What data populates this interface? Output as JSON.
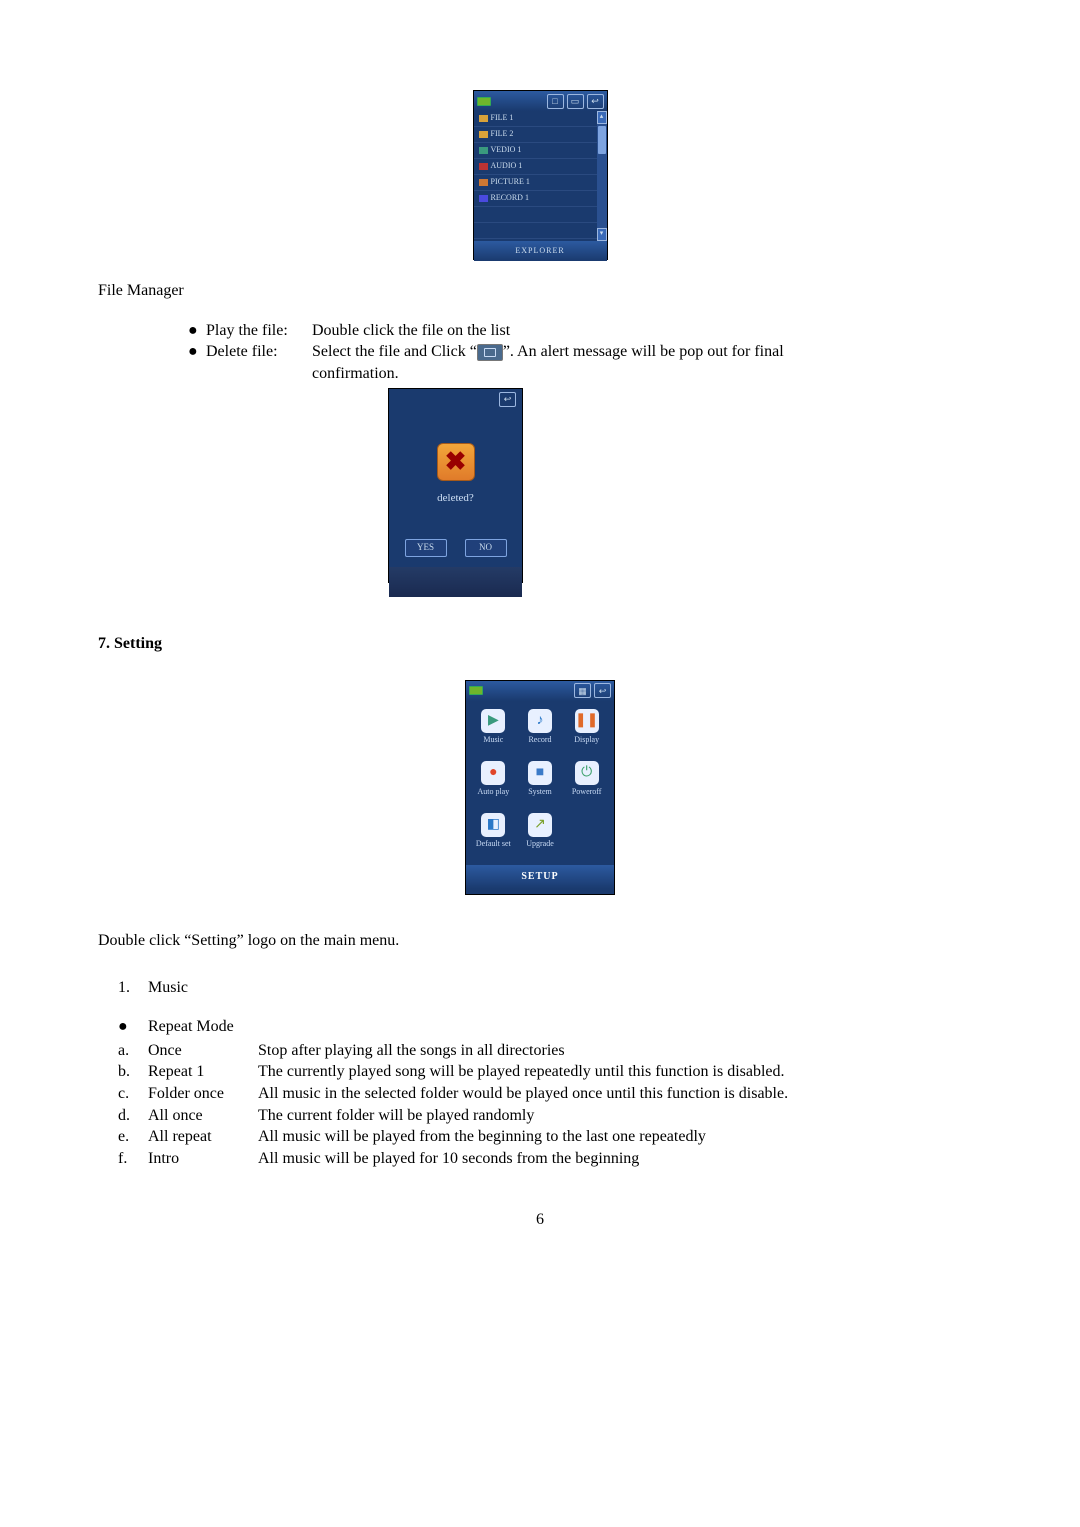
{
  "explorer": {
    "title": "EXPLORER",
    "items": [
      {
        "icon": "folder",
        "label": "FILE 1"
      },
      {
        "icon": "folder",
        "label": "FILE 2"
      },
      {
        "icon": "video",
        "label": "VEDIO 1"
      },
      {
        "icon": "audio",
        "label": "AUDIO 1"
      },
      {
        "icon": "pic",
        "label": "PICTURE 1"
      },
      {
        "icon": "rec",
        "label": "RECORD 1"
      }
    ]
  },
  "fileManager": {
    "heading": "File Manager",
    "play": {
      "label": "Play the file:",
      "desc": "Double click the file on the list"
    },
    "delete": {
      "label": "Delete file:",
      "desc_a": "Select the file and Click “",
      "desc_b": "”. An alert message will be pop out for final",
      "desc_c": "confirmation."
    }
  },
  "deleteDialog": {
    "prompt": "deleted?",
    "yes": "YES",
    "no": "NO"
  },
  "setting": {
    "heading": "7. Setting",
    "setup_label": "SETUP",
    "cells": [
      {
        "emoji": "▶",
        "color": "#3a9a7e",
        "label": "Music"
      },
      {
        "emoji": "♪",
        "color": "#2a78c8",
        "label": "Record"
      },
      {
        "emoji": "❚❚",
        "color": "#e06a2a",
        "label": "Display"
      },
      {
        "emoji": "●",
        "color": "#e0452a",
        "label": "Auto play"
      },
      {
        "emoji": "■",
        "color": "#3a7ac8",
        "label": "System"
      },
      {
        "emoji": "⏻",
        "color": "#3aa06a",
        "label": "Poweroff"
      },
      {
        "emoji": "◧",
        "color": "#2a78c8",
        "label": "Default set"
      },
      {
        "emoji": "↗",
        "color": "#7aa02a",
        "label": "Upgrade"
      }
    ],
    "intro": "Double click “Setting” logo on the main menu.",
    "music": {
      "idx": "1.",
      "label": "Music"
    },
    "repeat": {
      "heading": "Repeat Mode",
      "items": [
        {
          "letter": "a.",
          "name": "Once",
          "desc": "Stop after playing all the songs in all directories"
        },
        {
          "letter": "b.",
          "name": "Repeat 1",
          "desc": "The currently played song will be played repeatedly until this function is disabled."
        },
        {
          "letter": "c.",
          "name": "Folder once",
          "desc": "All music in the selected folder would be played once until this function is disable."
        },
        {
          "letter": "d.",
          "name": "All once",
          "desc": "The current folder will be played randomly"
        },
        {
          "letter": "e.",
          "name": "All repeat",
          "desc": "All music will be played from the beginning to the last one repeatedly"
        },
        {
          "letter": "f.",
          "name": "Intro",
          "desc": "All music will be played for 10 seconds from the beginning"
        }
      ]
    }
  },
  "glyphs": {
    "bullet": "●",
    "stop": "□",
    "back": "↩",
    "up": "▴",
    "down": "▾",
    "x": "✖",
    "delb": "▭"
  },
  "pageNumber": "6"
}
